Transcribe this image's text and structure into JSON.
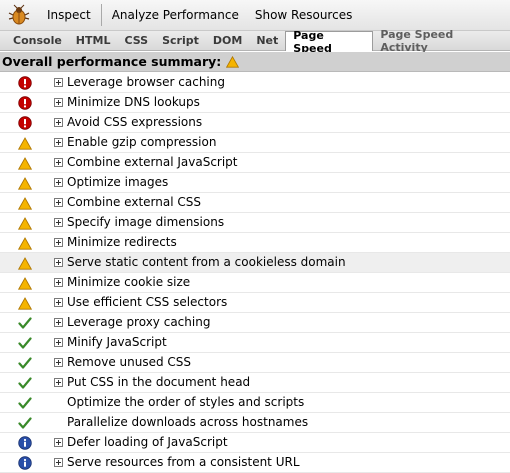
{
  "toolbar": {
    "inspect_label": "Inspect",
    "analyze_label": "Analyze Performance",
    "show_resources_label": "Show Resources"
  },
  "tabs": [
    {
      "label": "Console",
      "active": false
    },
    {
      "label": "HTML",
      "active": false
    },
    {
      "label": "CSS",
      "active": false
    },
    {
      "label": "Script",
      "active": false
    },
    {
      "label": "DOM",
      "active": false
    },
    {
      "label": "Net",
      "active": false
    },
    {
      "label": "Page Speed",
      "active": true
    },
    {
      "label": "Page Speed Activity",
      "active": false
    }
  ],
  "summary": {
    "label": "Overall performance summary:",
    "status_icon": "warning-icon"
  },
  "colors": {
    "error": "#c40000",
    "warning": "#f0a300",
    "pass": "#3a8a2a",
    "info": "#2a4fa8"
  },
  "rules": [
    {
      "label": "Leverage browser caching",
      "status": "error",
      "expandable": true
    },
    {
      "label": "Minimize DNS lookups",
      "status": "error",
      "expandable": true
    },
    {
      "label": "Avoid CSS expressions",
      "status": "error",
      "expandable": true
    },
    {
      "label": "Enable gzip compression",
      "status": "warning",
      "expandable": true
    },
    {
      "label": "Combine external JavaScript",
      "status": "warning",
      "expandable": true
    },
    {
      "label": "Optimize images",
      "status": "warning",
      "expandable": true
    },
    {
      "label": "Combine external CSS",
      "status": "warning",
      "expandable": true
    },
    {
      "label": "Specify image dimensions",
      "status": "warning",
      "expandable": true
    },
    {
      "label": "Minimize redirects",
      "status": "warning",
      "expandable": true
    },
    {
      "label": "Serve static content from a cookieless domain",
      "status": "warning",
      "expandable": true,
      "highlighted": true
    },
    {
      "label": "Minimize cookie size",
      "status": "warning",
      "expandable": true
    },
    {
      "label": "Use efficient CSS selectors",
      "status": "warning",
      "expandable": true
    },
    {
      "label": "Leverage proxy caching",
      "status": "pass",
      "expandable": true
    },
    {
      "label": "Minify JavaScript",
      "status": "pass",
      "expandable": true
    },
    {
      "label": "Remove unused CSS",
      "status": "pass",
      "expandable": true
    },
    {
      "label": "Put CSS in the document head",
      "status": "pass",
      "expandable": true
    },
    {
      "label": "Optimize the order of styles and scripts",
      "status": "pass",
      "expandable": false
    },
    {
      "label": "Parallelize downloads across hostnames",
      "status": "pass",
      "expandable": false
    },
    {
      "label": "Defer loading of JavaScript",
      "status": "info",
      "expandable": true
    },
    {
      "label": "Serve resources from a consistent URL",
      "status": "info",
      "expandable": true
    }
  ]
}
